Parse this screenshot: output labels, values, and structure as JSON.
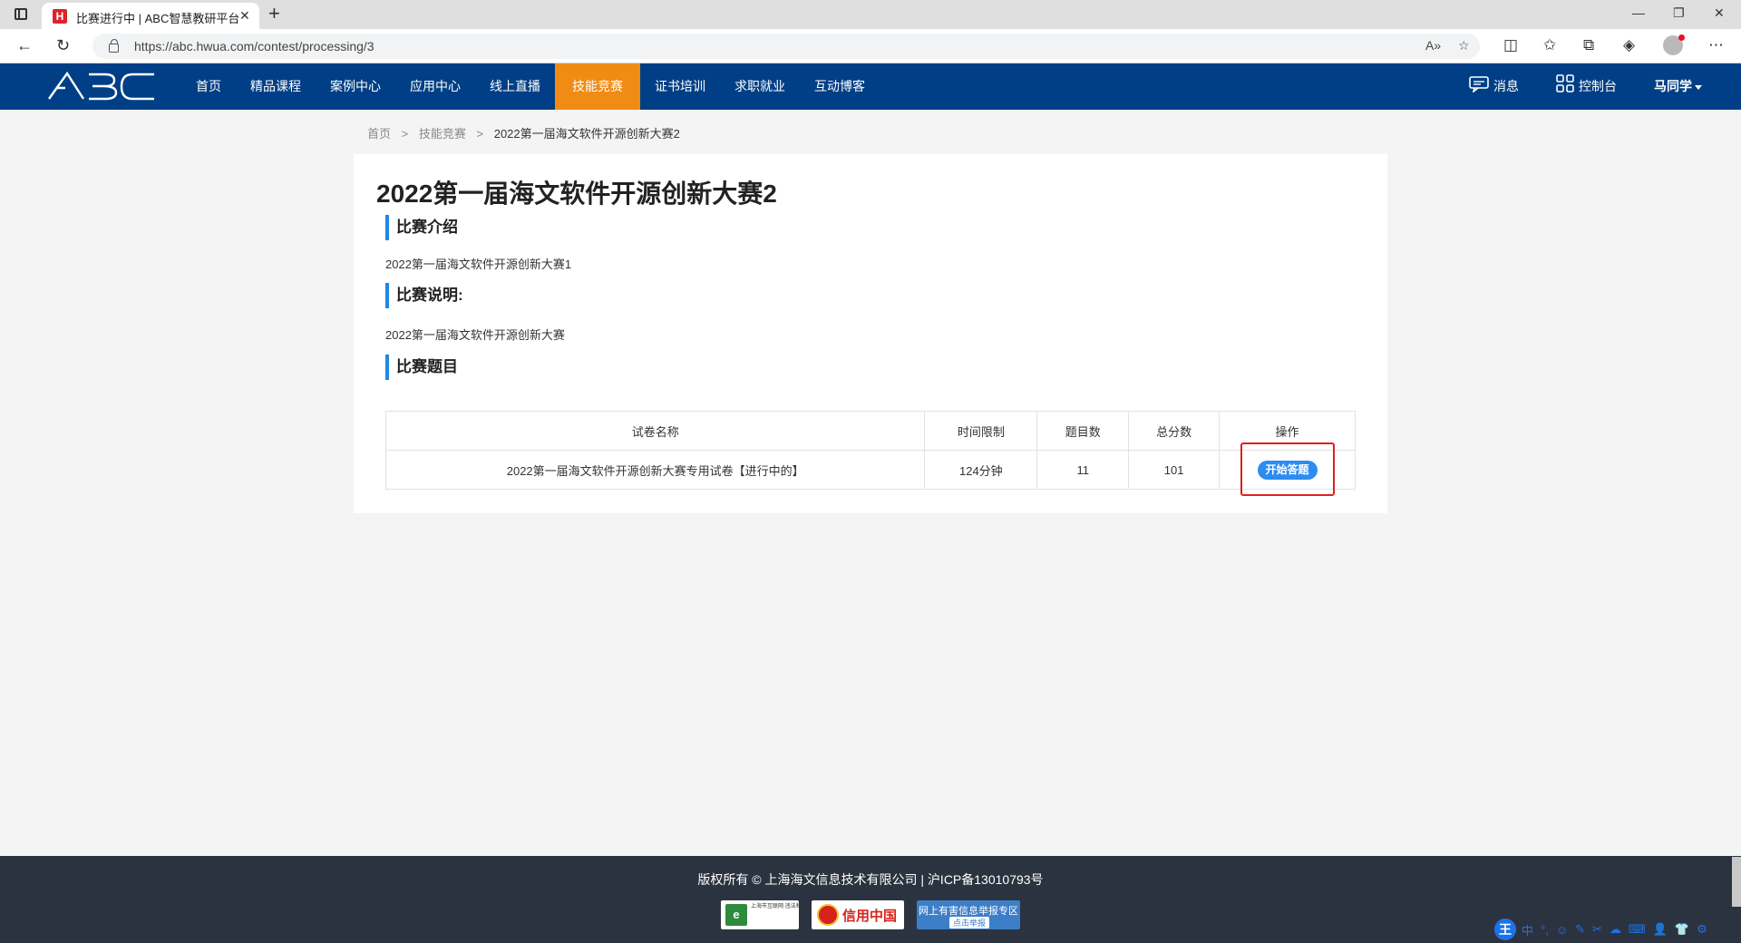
{
  "browser": {
    "tab_title": "比赛进行中 | ABC智慧教研平台",
    "favicon_letter": "H",
    "url": "https://abc.hwua.com/contest/processing/3"
  },
  "site": {
    "logo_text": "ABC",
    "menu": [
      {
        "label": "首页",
        "active": false
      },
      {
        "label": "精品课程",
        "active": false
      },
      {
        "label": "案例中心",
        "active": false
      },
      {
        "label": "应用中心",
        "active": false
      },
      {
        "label": "线上直播",
        "active": false
      },
      {
        "label": "技能竞赛",
        "active": true
      },
      {
        "label": "证书培训",
        "active": false
      },
      {
        "label": "求职就业",
        "active": false
      },
      {
        "label": "互动博客",
        "active": false
      }
    ],
    "messages_label": "消息",
    "console_label": "控制台",
    "user_name": "马同学"
  },
  "breadcrumb": {
    "home": "首页",
    "sep": ">",
    "section": "技能竞赛",
    "current": "2022第一届海文软件开源创新大赛2"
  },
  "contest": {
    "title": "2022第一届海文软件开源创新大赛2",
    "intro_heading": "比赛介绍",
    "intro_text": "2022第一届海文软件开源创新大赛1",
    "desc_heading": "比赛说明:",
    "desc_text": "2022第一届海文软件开源创新大赛",
    "questions_heading": "比赛题目"
  },
  "exam_table": {
    "headers": [
      "试卷名称",
      "时间限制",
      "题目数",
      "总分数",
      "操作"
    ],
    "rows": [
      {
        "name": "2022第一届海文软件开源创新大赛专用试卷【进行中的】",
        "time_limit": "124分钟",
        "question_count": "11",
        "total_score": "101",
        "action_label": "开始答题"
      }
    ]
  },
  "footer": {
    "copyright": "版权所有 © 上海海文信息技术有限公司 | 沪ICP备13010793号",
    "badge1_text": "上海市互联网 违法和不良 信息举报中心",
    "badge2_text": "信用中国",
    "badge3_line1": "网上有害信息举报专区",
    "badge3_line2": "点击举报"
  },
  "ime": {
    "items": [
      "中",
      "°,",
      "☺",
      "✎",
      "✂",
      "☁",
      "⌨",
      "👤",
      "👕",
      "⚙"
    ]
  },
  "colors": {
    "header_bg": "#003f86",
    "active_menu_bg": "#f08b14",
    "accent_blue": "#2d8cf0",
    "highlight_red": "#e0201e",
    "footer_bg": "#2c3340"
  }
}
